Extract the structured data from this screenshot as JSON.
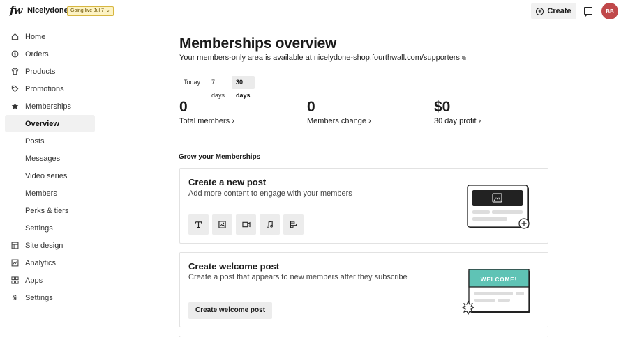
{
  "topbar": {
    "logo": "fw",
    "store_name": "Nicelydone",
    "golive_label": "Going live Jul 7",
    "create_label": "Create",
    "avatar_initials": "BB"
  },
  "sidebar": {
    "items": [
      {
        "label": "Home",
        "icon": "home-icon"
      },
      {
        "label": "Orders",
        "icon": "orders-icon"
      },
      {
        "label": "Products",
        "icon": "shirt-icon"
      },
      {
        "label": "Promotions",
        "icon": "tag-icon"
      },
      {
        "label": "Memberships",
        "icon": "star-icon"
      },
      {
        "label": "Overview",
        "active": true
      },
      {
        "label": "Posts"
      },
      {
        "label": "Messages"
      },
      {
        "label": "Video series"
      },
      {
        "label": "Members"
      },
      {
        "label": "Perks & tiers"
      },
      {
        "label": "Settings"
      },
      {
        "label": "Site design",
        "icon": "layout-icon"
      },
      {
        "label": "Analytics",
        "icon": "chart-icon"
      },
      {
        "label": "Apps",
        "icon": "apps-icon"
      },
      {
        "label": "Settings",
        "icon": "gear-icon"
      }
    ]
  },
  "main": {
    "title": "Memberships overview",
    "subtitle_prefix": "Your members-only area is available at ",
    "subtitle_link": "nicelydone-shop.fourthwall.com/supporters",
    "tabs": [
      "Today",
      "7 days",
      "30 days"
    ],
    "active_tab": "30 days",
    "stats": [
      {
        "value": "0",
        "label": "Total members"
      },
      {
        "value": "0",
        "label": "Members change"
      },
      {
        "value": "$0",
        "label": "30 day profit"
      }
    ],
    "section_heading": "Grow your Memberships",
    "cards": [
      {
        "title": "Create a new post",
        "description": "Add more content to engage with your members",
        "tools": [
          "text-icon",
          "image-icon",
          "video-icon",
          "audio-icon",
          "poll-icon"
        ]
      },
      {
        "title": "Create welcome post",
        "description": "Create a post that appears to new members after they subscribe",
        "button_label": "Create welcome post",
        "illustration_text": "WELCOME!"
      }
    ]
  },
  "colors": {
    "avatar": "#c0484a",
    "golive_bg": "#fdf3c4",
    "welcome_teal": "#5fc3b5"
  }
}
